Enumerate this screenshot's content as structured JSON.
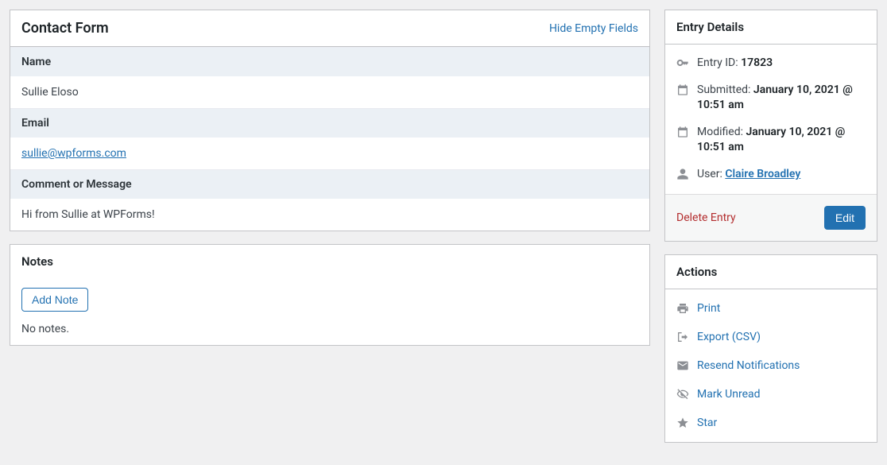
{
  "form": {
    "title": "Contact Form",
    "toggle": "Hide Empty Fields",
    "fields": {
      "name_label": "Name",
      "name_value": "Sullie Eloso",
      "email_label": "Email",
      "email_value": "sullie@wpforms.com",
      "message_label": "Comment or Message",
      "message_value": "Hi from Sullie at WPForms!"
    }
  },
  "notes": {
    "title": "Notes",
    "add_button": "Add Note",
    "empty": "No notes."
  },
  "details": {
    "title": "Entry Details",
    "entry_id_label": "Entry ID: ",
    "entry_id_value": "17823",
    "submitted_label": "Submitted: ",
    "submitted_value": "January 10, 2021 @ 10:51 am",
    "modified_label": "Modified: ",
    "modified_value": "January 10, 2021 @ 10:51 am",
    "user_label": "User: ",
    "user_value": "Claire Broadley",
    "delete": "Delete Entry",
    "edit": "Edit"
  },
  "actions": {
    "title": "Actions",
    "print": "Print",
    "export": "Export (CSV)",
    "resend": "Resend Notifications",
    "mark_unread": "Mark Unread",
    "star": "Star"
  }
}
